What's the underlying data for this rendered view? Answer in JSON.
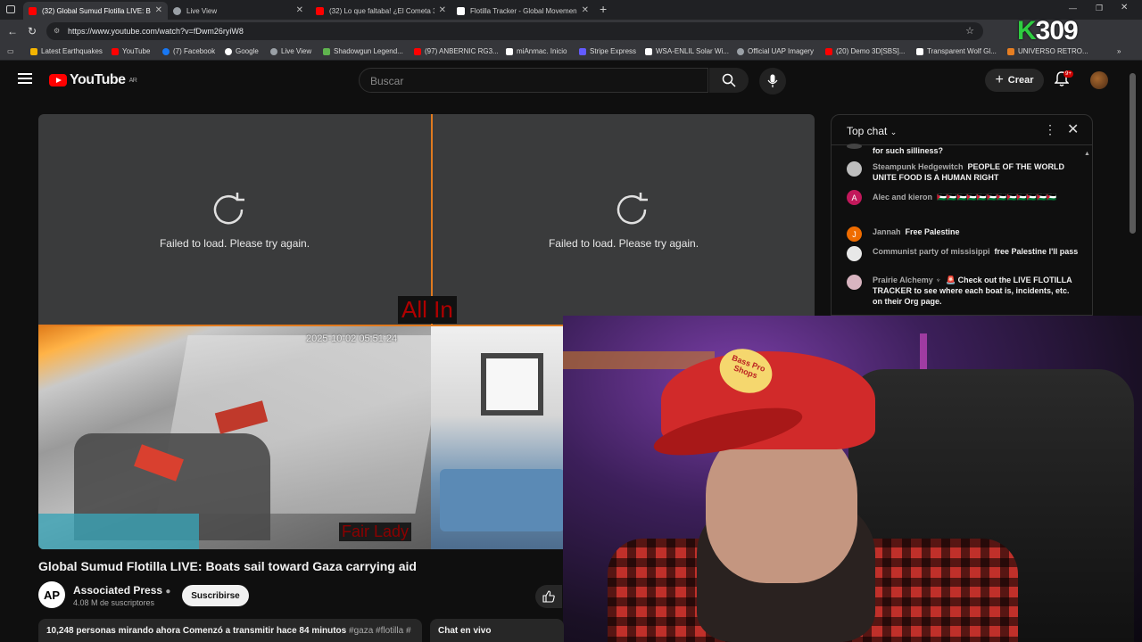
{
  "browser": {
    "tabs": [
      {
        "title": "(32) Global Sumud Flotilla LIVE: B",
        "color": "#ff0000",
        "active": true
      },
      {
        "title": "Live View",
        "color": "#9aa0a6",
        "active": false
      },
      {
        "title": "(32) Lo que faltaba! ¿El Cometa 3I",
        "color": "#ff0000",
        "active": false
      },
      {
        "title": "Flotilla Tracker - Global Movemen",
        "color": "#ffffff",
        "active": false
      }
    ],
    "url": "https://www.youtube.com/watch?v=fDwm26ryiW8",
    "bookmarks": [
      {
        "label": "Latest Earthquakes",
        "color": "#f4b400"
      },
      {
        "label": "YouTube",
        "color": "#ff0000"
      },
      {
        "label": "(7) Facebook",
        "color": "#1877f2"
      },
      {
        "label": "Google",
        "color": "#ffffff"
      },
      {
        "label": "Live View",
        "color": "#9aa0a6"
      },
      {
        "label": "Shadowgun Legend...",
        "color": "#5fb34e"
      },
      {
        "label": "(97) ANBERNIC RG3...",
        "color": "#ff0000"
      },
      {
        "label": "miAnmac. Inicio",
        "color": "#ffffff"
      },
      {
        "label": "Stripe Express",
        "color": "#635bff"
      },
      {
        "label": "WSA-ENLIL Solar Wi...",
        "color": "#ffffff"
      },
      {
        "label": "Official UAP Imagery",
        "color": "#9aa0a6"
      },
      {
        "label": "(20) Demo 3D[SBS]...",
        "color": "#ff0000"
      },
      {
        "label": "Transparent Wolf Gl...",
        "color": "#ffffff"
      },
      {
        "label": "UNIVERSO RETRO...",
        "color": "#e67e22"
      }
    ],
    "overlay_counter": {
      "prefix": "K",
      "value": "309"
    }
  },
  "youtube": {
    "logo_text": "YouTube",
    "region": "AR",
    "search_placeholder": "Buscar",
    "create_label": "Crear",
    "notification_count": "9+"
  },
  "player": {
    "failed_left": "Failed to load. Please try again.",
    "failed_right": "Failed to load. Please try again.",
    "banner_top": "All In",
    "timestamp": "2025-10-02 05:51:24",
    "banner_bottom": "Fair Lady",
    "cap_logo": "Bass Pro Shops"
  },
  "video": {
    "title": "Global Sumud Flotilla LIVE: Boats sail toward Gaza carrying aid",
    "channel": "Associated Press",
    "channel_initials": "AP",
    "subscribers": "4.08 M de suscriptores",
    "subscribe_label": "Suscribirse",
    "description_stats": "10,248 personas mirando ahora  Comenzó a transmitir hace 84 minutos",
    "description_tags": "#gaza #flotilla #",
    "chat_button": "Chat en vivo"
  },
  "chat": {
    "title": "Top chat",
    "messages": [
      {
        "author": "",
        "text": "for such silliness?",
        "avatar_color": "#444",
        "initial": ""
      },
      {
        "author": "Steampunk Hedgewitch",
        "text": "PEOPLE OF THE WORLD UNITE FOOD IS A HUMAN RIGHT",
        "avatar_color": "#bdbdbd",
        "initial": ""
      },
      {
        "author": "Alec and kieron",
        "text": "🇵🇸🇵🇸🇵🇸🇵🇸🇵🇸🇵🇸🇵🇸🇵🇸🇵🇸🇵🇸🇵🇸🇵🇸",
        "avatar_color": "#c2185b",
        "initial": "A"
      },
      {
        "author": "Jannah",
        "text": "Free Palestine",
        "avatar_color": "#ef6c00",
        "initial": "J"
      },
      {
        "author": "Communist party of missisippi",
        "text": "free Palestine I'll pass",
        "avatar_color": "#e8e8e8",
        "initial": ""
      },
      {
        "author": "Prairie Alchemy ♆",
        "text": "🚨 Check out the LIVE FLOTILLA TRACKER to see where each boat is, incidents, etc. on their Org page.",
        "avatar_color": "#d8b4c0",
        "initial": ""
      }
    ]
  }
}
